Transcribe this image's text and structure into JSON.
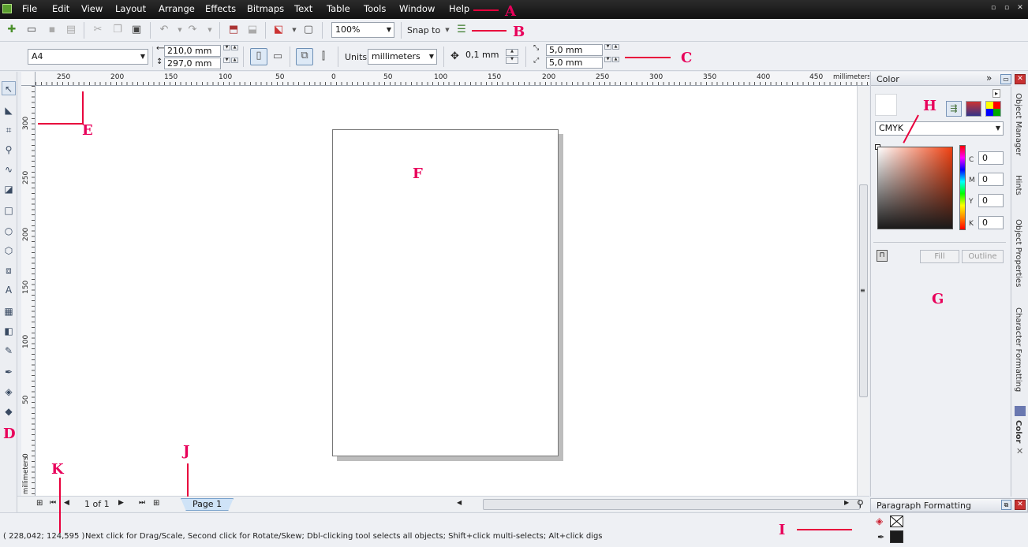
{
  "menubar": {
    "items": [
      "File",
      "Edit",
      "View",
      "Layout",
      "Arrange",
      "Effects",
      "Bitmaps",
      "Text",
      "Table",
      "Tools",
      "Window",
      "Help"
    ],
    "window_controls": [
      "▫",
      "▫",
      "✕"
    ]
  },
  "standard_toolbar": {
    "zoom": "100%",
    "snap_to": "Snap to"
  },
  "property_bar": {
    "paper_size": "A4",
    "width": "210,0 mm",
    "height": "297,0 mm",
    "units_label": "Units:",
    "units_value": "millimeters",
    "nudge": "0,1 mm",
    "dup_x": "5,0 mm",
    "dup_y": "5,0 mm"
  },
  "rulers": {
    "top_labels": [
      "250",
      "200",
      "150",
      "100",
      "50",
      "0",
      "50",
      "100",
      "150",
      "200",
      "250",
      "300",
      "350",
      "400",
      "450"
    ],
    "top_unit": "millimeters",
    "left_labels": [
      "300",
      "250",
      "200",
      "150",
      "100",
      "50",
      "0"
    ],
    "left_unit": "millimeters"
  },
  "page_nav": {
    "page_count": "1 of 1",
    "page_tab": "Page 1"
  },
  "statusbar": {
    "coords": "( 228,042; 124,595 )",
    "hint": "Next click for Drag/Scale, Second click for Rotate/Skew; Dbl-clicking tool selects all objects; Shift+click multi-selects; Alt+click digs"
  },
  "color_docker": {
    "title": "Color",
    "model": "CMYK",
    "channels": [
      {
        "label": "C",
        "value": "0"
      },
      {
        "label": "M",
        "value": "0"
      },
      {
        "label": "Y",
        "value": "0"
      },
      {
        "label": "K",
        "value": "0"
      }
    ],
    "fill_label": "Fill",
    "outline_label": "Outline"
  },
  "side_tabs": [
    "Object Manager",
    "Hints",
    "Object Properties",
    "Character Formatting",
    "Color"
  ],
  "paragraph_docker": {
    "title": "Paragraph Formatting"
  },
  "annotations": [
    "A",
    "B",
    "C",
    "D",
    "E",
    "F",
    "G",
    "H",
    "I",
    "J",
    "K"
  ],
  "colors": {
    "annotation": "#e8005a",
    "menubar_bg": "#1a1a1a",
    "page_tab_bg": "#cfe3f7"
  }
}
